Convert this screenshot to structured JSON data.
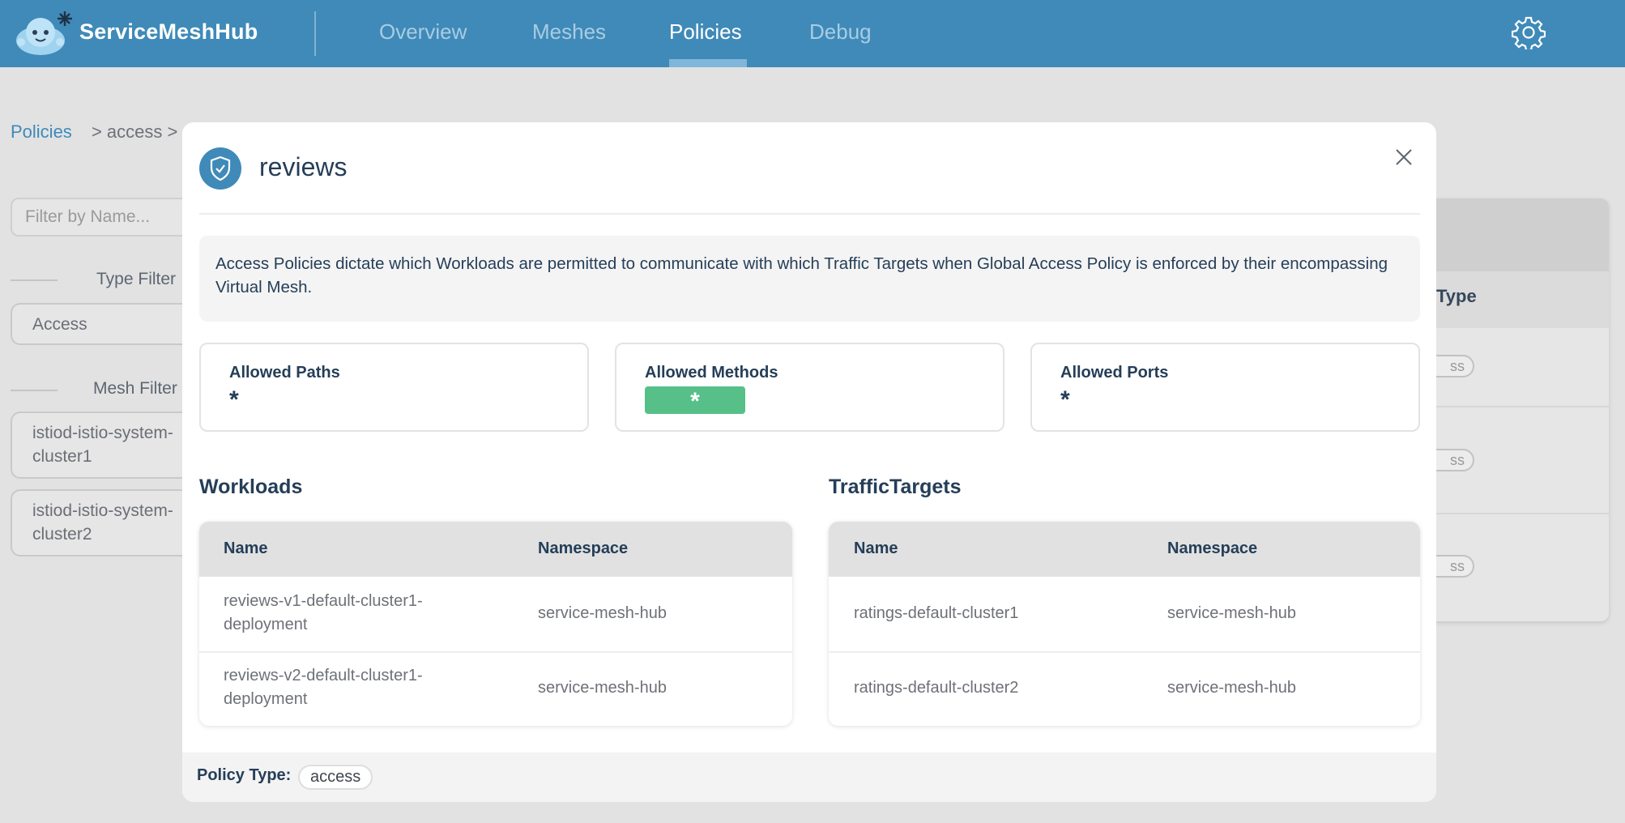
{
  "header": {
    "brand": "ServiceMeshHub",
    "nav": [
      "Overview",
      "Meshes",
      "Policies",
      "Debug"
    ],
    "active_nav": "Policies",
    "settings_icon": "gear-icon"
  },
  "background": {
    "breadcrumb": {
      "root": "Policies",
      "current": "> access  >"
    },
    "filter_placeholder": "Filter by Name...",
    "type_filter": {
      "label": "Type Filter",
      "options": [
        "Access"
      ]
    },
    "mesh_filter": {
      "label": "Mesh Filter",
      "options": [
        "istiod-istio-system-cluster1",
        "istiod-istio-system-cluster2"
      ]
    },
    "right_panel": {
      "column": "Type",
      "badges": [
        "ss",
        "ss",
        "ss"
      ]
    }
  },
  "modal": {
    "icon": "shield-check-icon",
    "title": "reviews",
    "close_icon": "close-icon",
    "description": "Access Policies dictate which Workloads are permitted to communicate with which Traffic Targets when Global Access Policy is enforced by their encompassing Virtual Mesh.",
    "cards": {
      "paths": {
        "label": "Allowed Paths",
        "value": "*"
      },
      "methods": {
        "label": "Allowed Methods",
        "value": "*"
      },
      "ports": {
        "label": "Allowed Ports",
        "value": "*"
      }
    },
    "workloads": {
      "title": "Workloads",
      "columns": [
        "Name",
        "Namespace"
      ],
      "rows": [
        {
          "name": "reviews-v1-default-cluster1-deployment",
          "namespace": "service-mesh-hub"
        },
        {
          "name": "reviews-v2-default-cluster1-deployment",
          "namespace": "service-mesh-hub"
        }
      ]
    },
    "traffic_targets": {
      "title": "TrafficTargets",
      "columns": [
        "Name",
        "Namespace"
      ],
      "rows": [
        {
          "name": "ratings-default-cluster1",
          "namespace": "service-mesh-hub"
        },
        {
          "name": "ratings-default-cluster2",
          "namespace": "service-mesh-hub"
        }
      ]
    },
    "footer": {
      "label": "Policy Type:",
      "value": "access"
    }
  },
  "colors": {
    "topbar": "#3f8ab8",
    "accent": "#3f8ab8",
    "methods_tag": "#56c088",
    "text": "#253e58"
  }
}
